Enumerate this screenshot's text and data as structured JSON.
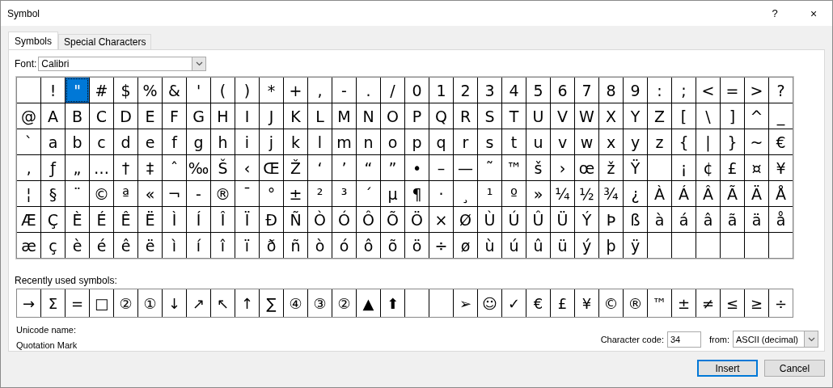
{
  "window": {
    "title": "Symbol",
    "help_button": "?",
    "close_button": "×"
  },
  "tabs": [
    {
      "label": "Symbols",
      "selected": true
    },
    {
      "label": "Special Characters",
      "selected": false
    }
  ],
  "font": {
    "label": "Font:",
    "value": "Calibri"
  },
  "symbol_grid": {
    "rows": [
      [
        {
          "selected": false
        },
        {
          "char": "!",
          "selected": false
        },
        {
          "char": "\"",
          "selected": true
        },
        {
          "char": "#",
          "selected": false
        },
        {
          "char": "$",
          "selected": false
        },
        {
          "char": "%",
          "selected": false
        },
        {
          "char": "&",
          "selected": false
        },
        {
          "char": "'",
          "selected": false
        },
        {
          "char": "(",
          "selected": false
        },
        {
          "char": ")",
          "selected": false
        },
        {
          "char": "*",
          "selected": false
        },
        {
          "char": "+",
          "selected": false
        },
        {
          "char": ",",
          "selected": false
        },
        {
          "char": "-",
          "selected": false
        },
        {
          "char": ".",
          "selected": false
        },
        {
          "char": "/",
          "selected": false
        },
        {
          "char": "0",
          "selected": false
        },
        {
          "char": "1",
          "selected": false
        },
        {
          "char": "2",
          "selected": false
        },
        {
          "char": "3",
          "selected": false
        },
        {
          "char": "4",
          "selected": false
        },
        {
          "char": "5",
          "selected": false
        },
        {
          "char": "6",
          "selected": false
        },
        {
          "char": "7",
          "selected": false
        },
        {
          "char": "8",
          "selected": false
        },
        {
          "char": "9",
          "selected": false
        },
        {
          "char": ":",
          "selected": false
        },
        {
          "char": ";",
          "selected": false
        },
        {
          "char": "<",
          "selected": false
        },
        {
          "char": "=",
          "selected": false
        },
        {
          "char": ">",
          "selected": false
        },
        {
          "char": "?",
          "selected": false
        }
      ],
      [
        {
          "char": "@",
          "selected": false
        },
        {
          "char": "A",
          "selected": false
        },
        {
          "char": "B",
          "selected": false
        },
        {
          "char": "C",
          "selected": false
        },
        {
          "char": "D",
          "selected": false
        },
        {
          "char": "E",
          "selected": false
        },
        {
          "char": "F",
          "selected": false
        },
        {
          "char": "G",
          "selected": false
        },
        {
          "char": "H",
          "selected": false
        },
        {
          "char": "I",
          "selected": false
        },
        {
          "char": "J",
          "selected": false
        },
        {
          "char": "K",
          "selected": false
        },
        {
          "char": "L",
          "selected": false
        },
        {
          "char": "M",
          "selected": false
        },
        {
          "char": "N",
          "selected": false
        },
        {
          "char": "O",
          "selected": false
        },
        {
          "char": "P",
          "selected": false
        },
        {
          "char": "Q",
          "selected": false
        },
        {
          "char": "R",
          "selected": false
        },
        {
          "char": "S",
          "selected": false
        },
        {
          "char": "T",
          "selected": false
        },
        {
          "char": "U",
          "selected": false
        },
        {
          "char": "V",
          "selected": false
        },
        {
          "char": "W",
          "selected": false
        },
        {
          "char": "X",
          "selected": false
        },
        {
          "char": "Y",
          "selected": false
        },
        {
          "char": "Z",
          "selected": false
        },
        {
          "char": "[",
          "selected": false
        },
        {
          "char": "\\",
          "selected": false
        },
        {
          "char": "]",
          "selected": false
        },
        {
          "char": "^",
          "selected": false
        },
        {
          "char": "_",
          "selected": false
        }
      ],
      [
        {
          "char": "`",
          "selected": false
        },
        {
          "char": "a",
          "selected": false
        },
        {
          "char": "b",
          "selected": false
        },
        {
          "char": "c",
          "selected": false
        },
        {
          "char": "d",
          "selected": false
        },
        {
          "char": "e",
          "selected": false
        },
        {
          "char": "f",
          "selected": false
        },
        {
          "char": "g",
          "selected": false
        },
        {
          "char": "h",
          "selected": false
        },
        {
          "char": "i",
          "selected": false
        },
        {
          "char": "j",
          "selected": false
        },
        {
          "char": "k",
          "selected": false
        },
        {
          "char": "l",
          "selected": false
        },
        {
          "char": "m",
          "selected": false
        },
        {
          "char": "n",
          "selected": false
        },
        {
          "char": "o",
          "selected": false
        },
        {
          "char": "p",
          "selected": false
        },
        {
          "char": "q",
          "selected": false
        },
        {
          "char": "r",
          "selected": false
        },
        {
          "char": "s",
          "selected": false
        },
        {
          "char": "t",
          "selected": false
        },
        {
          "char": "u",
          "selected": false
        },
        {
          "char": "v",
          "selected": false
        },
        {
          "char": "w",
          "selected": false
        },
        {
          "char": "x",
          "selected": false
        },
        {
          "char": "y",
          "selected": false
        },
        {
          "char": "z",
          "selected": false
        },
        {
          "char": "{",
          "selected": false
        },
        {
          "char": "|",
          "selected": false
        },
        {
          "char": "}",
          "selected": false
        },
        {
          "char": "~",
          "selected": false
        },
        {
          "char": "€",
          "selected": false
        }
      ],
      [
        {
          "char": "‚",
          "selected": false
        },
        {
          "char": "ƒ",
          "selected": false
        },
        {
          "char": "„",
          "selected": false
        },
        {
          "char": "…",
          "selected": false
        },
        {
          "char": "†",
          "selected": false
        },
        {
          "char": "‡",
          "selected": false
        },
        {
          "char": "ˆ",
          "selected": false
        },
        {
          "char": "‰",
          "selected": false
        },
        {
          "char": "Š",
          "selected": false
        },
        {
          "char": "‹",
          "selected": false
        },
        {
          "char": "Œ",
          "selected": false
        },
        {
          "char": "Ž",
          "selected": false
        },
        {
          "char": "‘",
          "selected": false
        },
        {
          "char": "’",
          "selected": false
        },
        {
          "char": "“",
          "selected": false
        },
        {
          "char": "”",
          "selected": false
        },
        {
          "char": "•",
          "selected": false
        },
        {
          "char": "–",
          "selected": false
        },
        {
          "char": "—",
          "selected": false
        },
        {
          "char": "˜",
          "selected": false
        },
        {
          "char": "™",
          "selected": false
        },
        {
          "char": "š",
          "selected": false
        },
        {
          "char": "›",
          "selected": false
        },
        {
          "char": "œ",
          "selected": false
        },
        {
          "char": "ž",
          "selected": false
        },
        {
          "char": "Ÿ",
          "selected": false
        },
        {
          "selected": false
        },
        {
          "char": "¡",
          "selected": false
        },
        {
          "char": "¢",
          "selected": false
        },
        {
          "char": "£",
          "selected": false
        },
        {
          "char": "¤",
          "selected": false
        },
        {
          "char": "¥",
          "selected": false
        }
      ],
      [
        {
          "char": "¦",
          "selected": false
        },
        {
          "char": "§",
          "selected": false
        },
        {
          "char": "¨",
          "selected": false
        },
        {
          "char": "©",
          "selected": false
        },
        {
          "char": "ª",
          "selected": false
        },
        {
          "char": "«",
          "selected": false
        },
        {
          "char": "¬",
          "selected": false
        },
        {
          "char": "-",
          "selected": false
        },
        {
          "char": "®",
          "selected": false
        },
        {
          "char": "¯",
          "selected": false
        },
        {
          "char": "°",
          "selected": false
        },
        {
          "char": "±",
          "selected": false
        },
        {
          "char": "²",
          "selected": false
        },
        {
          "char": "³",
          "selected": false
        },
        {
          "char": "´",
          "selected": false
        },
        {
          "char": "µ",
          "selected": false
        },
        {
          "char": "¶",
          "selected": false
        },
        {
          "char": "·",
          "selected": false
        },
        {
          "char": "¸",
          "selected": false
        },
        {
          "char": "¹",
          "selected": false
        },
        {
          "char": "º",
          "selected": false
        },
        {
          "char": "»",
          "selected": false
        },
        {
          "char": "¼",
          "selected": false
        },
        {
          "char": "½",
          "selected": false
        },
        {
          "char": "¾",
          "selected": false
        },
        {
          "char": "¿",
          "selected": false
        },
        {
          "char": "À",
          "selected": false
        },
        {
          "char": "Á",
          "selected": false
        },
        {
          "char": "Â",
          "selected": false
        },
        {
          "char": "Ã",
          "selected": false
        },
        {
          "char": "Ä",
          "selected": false
        },
        {
          "char": "Å",
          "selected": false
        }
      ],
      [
        {
          "char": "Æ",
          "selected": false
        },
        {
          "char": "Ç",
          "selected": false
        },
        {
          "char": "È",
          "selected": false
        },
        {
          "char": "É",
          "selected": false
        },
        {
          "char": "Ê",
          "selected": false
        },
        {
          "char": "Ë",
          "selected": false
        },
        {
          "char": "Ì",
          "selected": false
        },
        {
          "char": "Í",
          "selected": false
        },
        {
          "char": "Î",
          "selected": false
        },
        {
          "char": "Ï",
          "selected": false
        },
        {
          "char": "Ð",
          "selected": false
        },
        {
          "char": "Ñ",
          "selected": false
        },
        {
          "char": "Ò",
          "selected": false
        },
        {
          "char": "Ó",
          "selected": false
        },
        {
          "char": "Ô",
          "selected": false
        },
        {
          "char": "Õ",
          "selected": false
        },
        {
          "char": "Ö",
          "selected": false
        },
        {
          "char": "×",
          "selected": false
        },
        {
          "char": "Ø",
          "selected": false
        },
        {
          "char": "Ù",
          "selected": false
        },
        {
          "char": "Ú",
          "selected": false
        },
        {
          "char": "Û",
          "selected": false
        },
        {
          "char": "Ü",
          "selected": false
        },
        {
          "char": "Ý",
          "selected": false
        },
        {
          "char": "Þ",
          "selected": false
        },
        {
          "char": "ß",
          "selected": false
        },
        {
          "char": "à",
          "selected": false
        },
        {
          "char": "á",
          "selected": false
        },
        {
          "char": "â",
          "selected": false
        },
        {
          "char": "ã",
          "selected": false
        },
        {
          "char": "ä",
          "selected": false
        },
        {
          "char": "å",
          "selected": false
        }
      ],
      [
        {
          "char": "æ",
          "selected": false
        },
        {
          "char": "ç",
          "selected": false
        },
        {
          "char": "è",
          "selected": false
        },
        {
          "char": "é",
          "selected": false
        },
        {
          "char": "ê",
          "selected": false
        },
        {
          "char": "ë",
          "selected": false
        },
        {
          "char": "ì",
          "selected": false
        },
        {
          "char": "í",
          "selected": false
        },
        {
          "char": "î",
          "selected": false
        },
        {
          "char": "ï",
          "selected": false
        },
        {
          "char": "ð",
          "selected": false
        },
        {
          "char": "ñ",
          "selected": false
        },
        {
          "char": "ò",
          "selected": false
        },
        {
          "char": "ó",
          "selected": false
        },
        {
          "char": "ô",
          "selected": false
        },
        {
          "char": "õ",
          "selected": false
        },
        {
          "char": "ö",
          "selected": false
        },
        {
          "char": "÷",
          "selected": false
        },
        {
          "char": "ø",
          "selected": false
        },
        {
          "char": "ù",
          "selected": false
        },
        {
          "char": "ú",
          "selected": false
        },
        {
          "char": "û",
          "selected": false
        },
        {
          "char": "ü",
          "selected": false
        },
        {
          "char": "ý",
          "selected": false
        },
        {
          "char": "þ",
          "selected": false
        },
        {
          "char": "ÿ",
          "selected": false
        },
        {
          "selected": false
        },
        {
          "selected": false
        },
        {
          "selected": false
        },
        {
          "selected": false
        },
        {
          "selected": false
        },
        {
          "selected": false
        }
      ]
    ]
  },
  "recently_used": {
    "label": "Recently used symbols:",
    "symbols": [
      {
        "kind": "symbol",
        "char": "→"
      },
      {
        "kind": "symbol",
        "char": "Σ"
      },
      {
        "kind": "symbol",
        "char": "="
      },
      {
        "kind": "symbol",
        "char": "□"
      },
      {
        "kind": "symbol",
        "char": "②"
      },
      {
        "kind": "symbol",
        "char": "①"
      },
      {
        "kind": "symbol",
        "char": "↓"
      },
      {
        "kind": "symbol",
        "char": "↗"
      },
      {
        "kind": "symbol",
        "char": "↖"
      },
      {
        "kind": "symbol",
        "char": "↑"
      },
      {
        "kind": "symbol",
        "char": "∑"
      },
      {
        "kind": "symbol",
        "char": "④"
      },
      {
        "kind": "symbol",
        "char": "③"
      },
      {
        "kind": "symbol",
        "char": "②"
      },
      {
        "kind": "symbol",
        "char": "▲"
      },
      {
        "kind": "symbol",
        "char": "⬆"
      },
      {
        "kind": "empty"
      },
      {
        "kind": "empty"
      },
      {
        "kind": "symbol",
        "char": "➢"
      },
      {
        "kind": "symbol",
        "char": "☺"
      },
      {
        "kind": "symbol",
        "char": "✓"
      },
      {
        "kind": "symbol",
        "char": "€"
      },
      {
        "kind": "symbol",
        "char": "£"
      },
      {
        "kind": "symbol",
        "char": "¥"
      },
      {
        "kind": "symbol",
        "char": "©"
      },
      {
        "kind": "symbol",
        "char": "®"
      },
      {
        "kind": "symbol",
        "char": "™"
      },
      {
        "kind": "symbol",
        "char": "±"
      },
      {
        "kind": "symbol",
        "char": "≠"
      },
      {
        "kind": "symbol",
        "char": "≤"
      },
      {
        "kind": "symbol",
        "char": "≥"
      },
      {
        "kind": "symbol",
        "char": "÷"
      }
    ]
  },
  "unicode_name": {
    "label": "Unicode name:",
    "value": "Quotation Mark"
  },
  "character_code": {
    "label": "Character code:",
    "value": "34"
  },
  "from": {
    "label": "from:",
    "value": "ASCII (decimal)"
  },
  "buttons": [
    {
      "label": "Insert",
      "default": true
    },
    {
      "label": "Cancel",
      "default": false
    }
  ]
}
